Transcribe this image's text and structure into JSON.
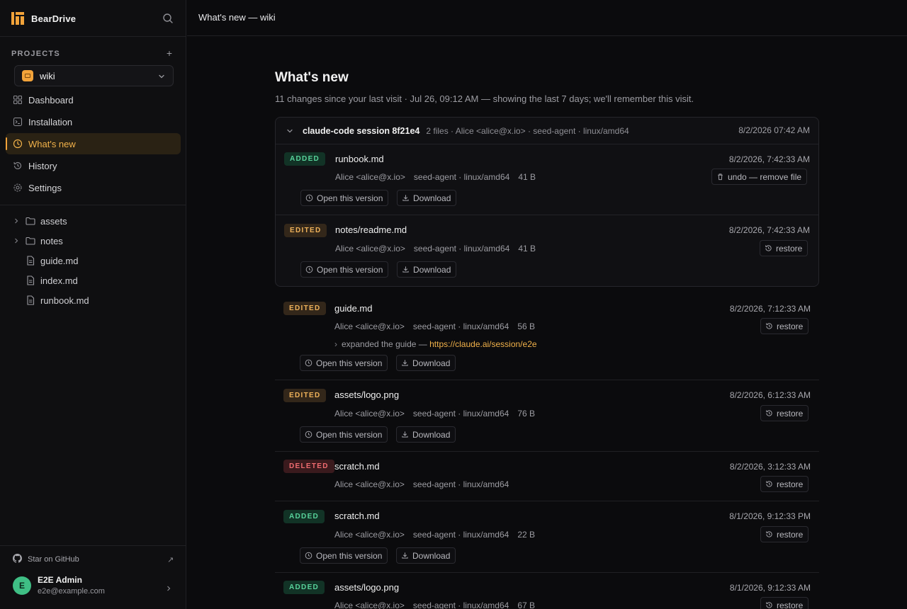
{
  "brand": {
    "name": "BearDrive",
    "logo_icon": "beardrive-logo-icon",
    "accent": "#f2a33a"
  },
  "sidebar": {
    "projects_label": "PROJECTS",
    "add_label": "+",
    "project": {
      "name": "wiki"
    },
    "nav": [
      {
        "label": "Dashboard",
        "icon": "dashboard-icon"
      },
      {
        "label": "Installation",
        "icon": "terminal-icon"
      },
      {
        "label": "What's new",
        "icon": "clock-icon",
        "active": true
      },
      {
        "label": "History",
        "icon": "history-icon"
      },
      {
        "label": "Settings",
        "icon": "gear-icon"
      }
    ],
    "tree": [
      {
        "label": "assets",
        "type": "folder"
      },
      {
        "label": "notes",
        "type": "folder"
      },
      {
        "label": "guide.md",
        "type": "file"
      },
      {
        "label": "index.md",
        "type": "file"
      },
      {
        "label": "runbook.md",
        "type": "file"
      }
    ],
    "github_label": "Star on GitHub",
    "github_ext": "↗",
    "user": {
      "initial": "E",
      "name": "E2E Admin",
      "email": "e2e@example.com"
    }
  },
  "topbar": {
    "title": "What's new — wiki"
  },
  "main": {
    "title": "What's new",
    "subtitle": "11 changes since your last visit · Jul 26, 09:12 AM — showing the last 7 days; we'll remember this visit.",
    "actions": {
      "open": "Open this version",
      "download": "Download",
      "restore": "restore",
      "undo": "undo — remove file"
    },
    "session": {
      "title": "claude-code session 8f21e4",
      "meta": "2 files · Alice <alice@x.io> · seed-agent · linux/amd64",
      "time": "8/2/2026 07:42 AM"
    },
    "entries": [
      {
        "badge": "ADDED",
        "file": "runbook.md",
        "author": "Alice <alice@x.io>",
        "agent": "seed-agent · linux/amd64",
        "size": "41 B",
        "time": "8/2/2026, 7:42:33 AM"
      },
      {
        "badge": "EDITED",
        "file": "notes/readme.md",
        "author": "Alice <alice@x.io>",
        "agent": "seed-agent · linux/amd64",
        "size": "41 B",
        "time": "8/2/2026, 7:42:33 AM"
      },
      {
        "badge": "EDITED",
        "file": "guide.md",
        "author": "Alice <alice@x.io>",
        "agent": "seed-agent · linux/amd64",
        "size": "56 B",
        "time": "8/2/2026, 7:12:33 AM",
        "note_text": "expanded the guide — ",
        "note_link": "https://claude.ai/session/e2e"
      },
      {
        "badge": "EDITED",
        "file": "assets/logo.png",
        "author": "Alice <alice@x.io>",
        "agent": "seed-agent · linux/amd64",
        "size": "76 B",
        "time": "8/2/2026, 6:12:33 AM"
      },
      {
        "badge": "DELETED",
        "file": "scratch.md",
        "author": "Alice <alice@x.io>",
        "agent": "seed-agent · linux/amd64",
        "time": "8/2/2026, 3:12:33 AM"
      },
      {
        "badge": "ADDED",
        "file": "scratch.md",
        "author": "Alice <alice@x.io>",
        "agent": "seed-agent · linux/amd64",
        "size": "22 B",
        "time": "8/1/2026, 9:12:33 PM"
      },
      {
        "badge": "ADDED",
        "file": "assets/logo.png",
        "author": "Alice <alice@x.io>",
        "agent": "seed-agent · linux/amd64",
        "size": "67 B",
        "time": "8/1/2026, 9:12:33 AM"
      }
    ]
  }
}
